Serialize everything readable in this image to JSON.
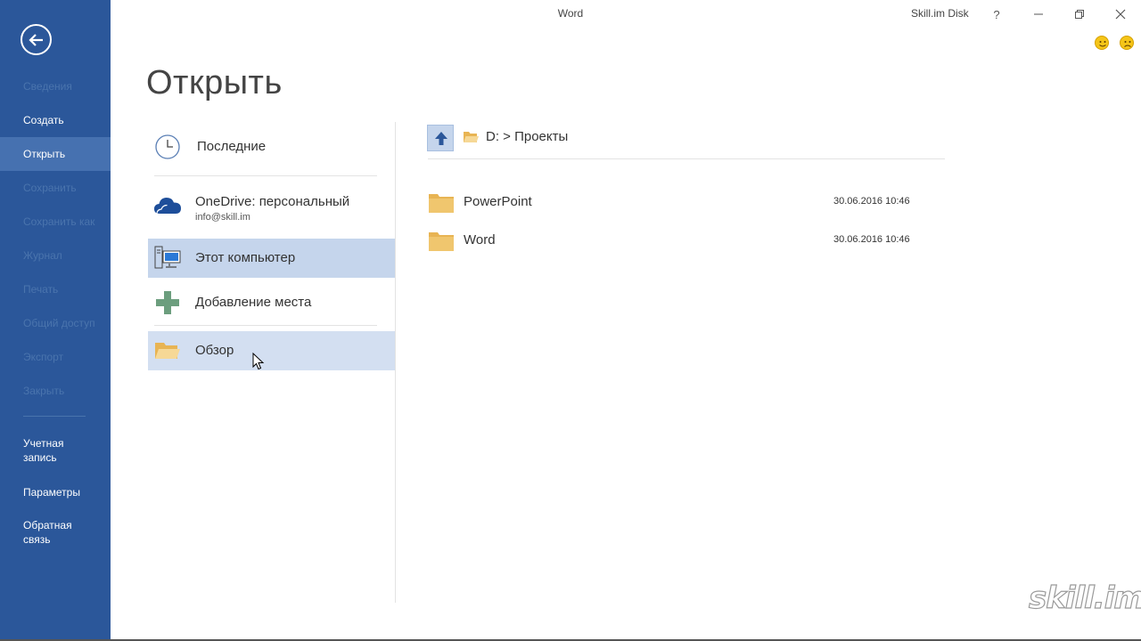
{
  "window": {
    "title": "Word",
    "account": "Skill.im Disk",
    "help": "?",
    "minimize": "—",
    "restore": "❐",
    "close": "✕"
  },
  "nav": {
    "back_icon": "back-arrow-icon",
    "items": [
      {
        "label": "Сведения",
        "state": "disabled"
      },
      {
        "label": "Создать",
        "state": "enabled"
      },
      {
        "label": "Открыть",
        "state": "active"
      },
      {
        "label": "Сохранить",
        "state": "disabled"
      },
      {
        "label": "Сохранить как",
        "state": "disabled"
      },
      {
        "label": "Журнал",
        "state": "disabled"
      },
      {
        "label": "Печать",
        "state": "disabled"
      },
      {
        "label": "Общий доступ",
        "state": "disabled"
      },
      {
        "label": "Экспорт",
        "state": "disabled"
      },
      {
        "label": "Закрыть",
        "state": "disabled"
      }
    ],
    "bottom": [
      {
        "label": "Учетная\nзапись"
      },
      {
        "label": "Параметры"
      },
      {
        "label": "Обратная\nсвязь"
      }
    ]
  },
  "page": {
    "title": "Открыть"
  },
  "places": [
    {
      "label": "Последние",
      "icon": "clock-icon"
    },
    {
      "label": "OneDrive: персональный",
      "sub": "info@skill.im",
      "icon": "onedrive-cloud-icon"
    },
    {
      "label": "Этот компьютер",
      "icon": "computer-icon",
      "selected": true
    },
    {
      "label": "Добавление места",
      "icon": "plus-icon"
    },
    {
      "label": "Обзор",
      "icon": "folder-open-icon",
      "hover": true
    }
  ],
  "browser": {
    "path": "D: > Проекты",
    "up_icon": "arrow-up-icon",
    "files": [
      {
        "name": "PowerPoint",
        "date": "30.06.2016 10:46",
        "icon": "folder-icon"
      },
      {
        "name": "Word",
        "date": "30.06.2016 10:46",
        "icon": "folder-icon"
      }
    ]
  },
  "watermark": "skill.im",
  "colors": {
    "nav_bg": "#2b579a",
    "nav_active": "#4671b0",
    "selected_bg": "#c5d5ec",
    "folder": "#f0c66e"
  }
}
